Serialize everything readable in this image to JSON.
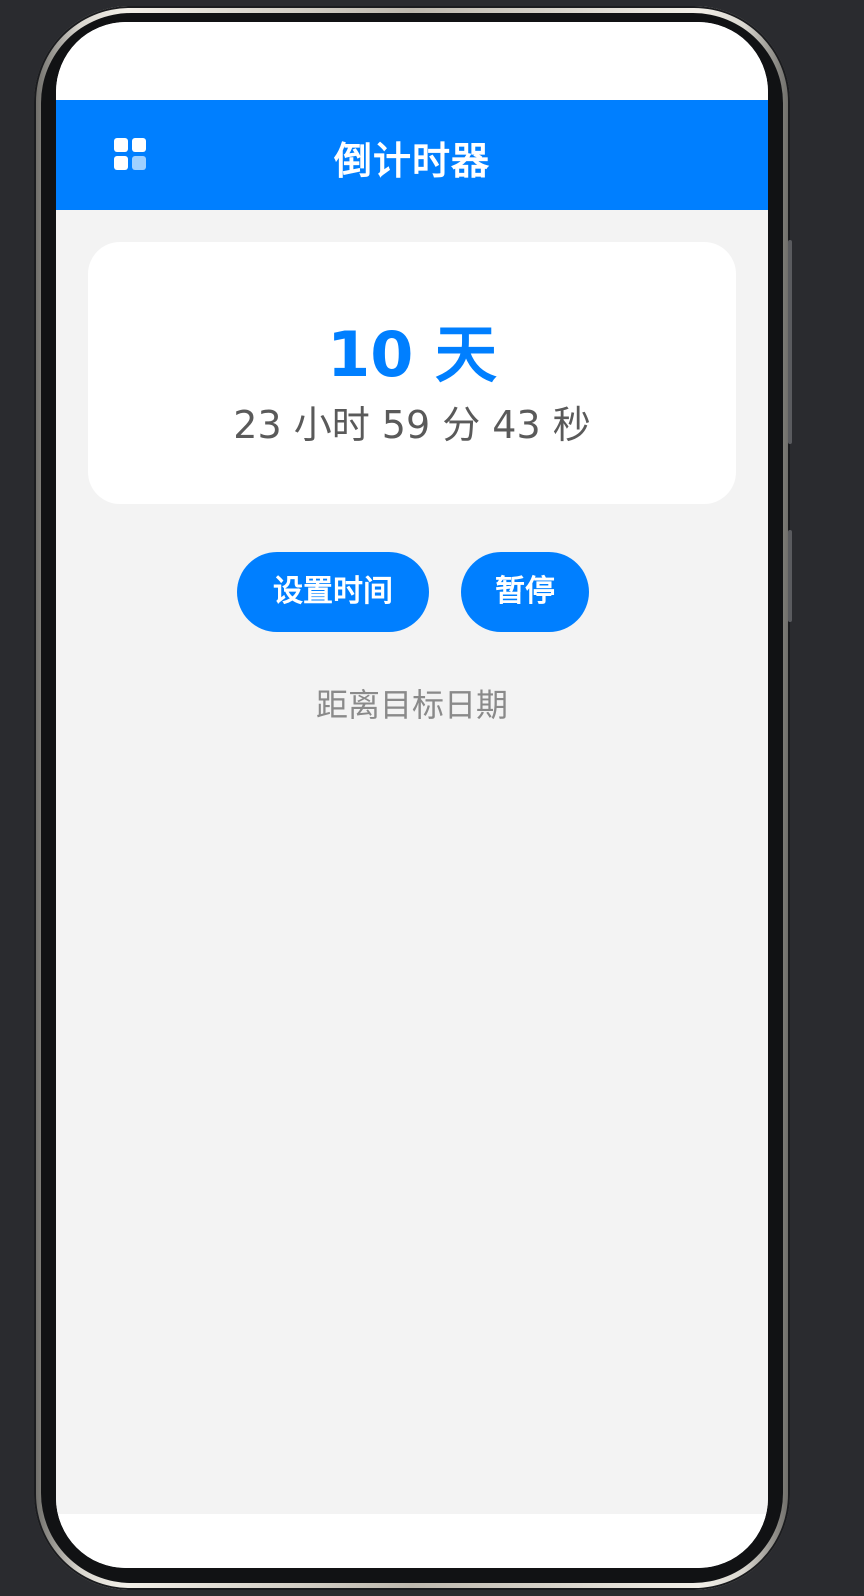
{
  "header": {
    "menu_icon": "grid-menu-icon",
    "title": "倒计时器",
    "background_color": "#007fff"
  },
  "countdown": {
    "days_text": "10 天",
    "time_text": "23 小时 59 分 43 秒"
  },
  "actions": {
    "set_time_label": "设置时间",
    "pause_label": "暂停"
  },
  "target_label": "距离目标日期",
  "colors": {
    "accent": "#007fff",
    "page_background": "#f3f3f3",
    "card_background": "#ffffff",
    "secondary_text": "#5a5a5a",
    "muted_text": "#8a8a8a"
  }
}
